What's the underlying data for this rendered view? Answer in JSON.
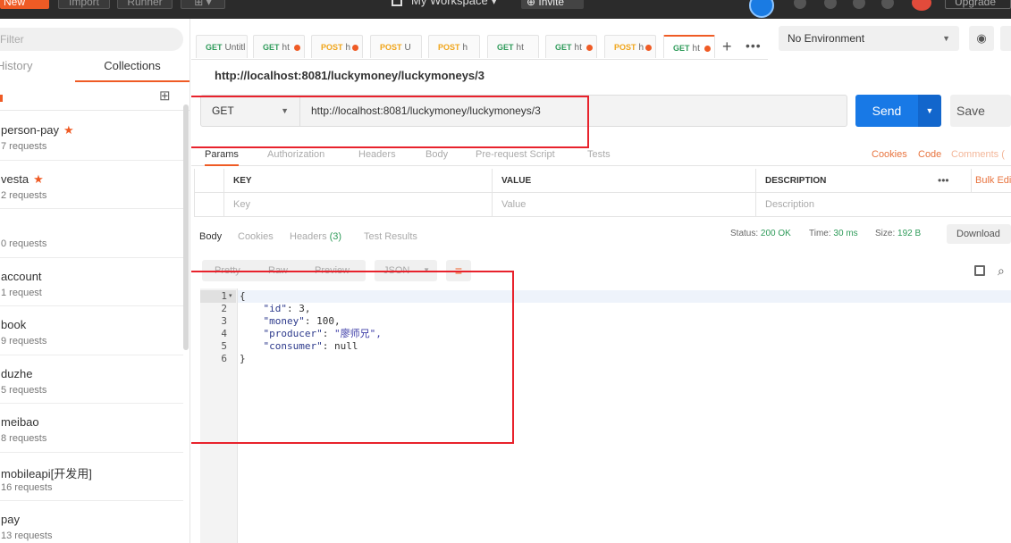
{
  "topbar": {
    "new_label": "New",
    "import_label": "Import",
    "runner_label": "Runner",
    "workspace_label": "My Workspace",
    "invite_label": "Invite",
    "upgrade_label": "Upgrade"
  },
  "sidebar": {
    "filter_placeholder": "Filter",
    "tab_history": "History",
    "tab_collections": "Collections",
    "collections": [
      {
        "name": "person-pay",
        "count": "7 requests",
        "starred": true
      },
      {
        "name": "vesta",
        "count": "2 requests",
        "starred": true
      },
      {
        "name": "",
        "count": "0 requests",
        "starred": false
      },
      {
        "name": "account",
        "count": "1 request",
        "starred": false
      },
      {
        "name": "book",
        "count": "9 requests",
        "starred": false
      },
      {
        "name": "duzhe",
        "count": "5 requests",
        "starred": false
      },
      {
        "name": "meibao",
        "count": "8 requests",
        "starred": false
      },
      {
        "name": "mobileapi[开发用]",
        "count": "16 requests",
        "starred": false
      },
      {
        "name": "pay",
        "count": "13 requests",
        "starred": false
      }
    ]
  },
  "tabs": [
    {
      "method": "GET",
      "title": "Untitl",
      "dot": false
    },
    {
      "method": "GET",
      "title": "ht",
      "dot": true
    },
    {
      "method": "POST",
      "title": "h",
      "dot": true
    },
    {
      "method": "POST",
      "title": "U",
      "dot": false
    },
    {
      "method": "POST",
      "title": "h",
      "dot": false
    },
    {
      "method": "GET",
      "title": "ht",
      "dot": false
    },
    {
      "method": "GET",
      "title": "ht",
      "dot": true
    },
    {
      "method": "POST",
      "title": "h",
      "dot": true
    },
    {
      "method": "GET",
      "title": "ht",
      "dot": true
    }
  ],
  "environment": {
    "selected": "No Environment"
  },
  "request": {
    "title": "http://localhost:8081/luckymoney/luckymoneys/3",
    "method": "GET",
    "url": "http://localhost:8081/luckymoney/luckymoneys/3",
    "send_label": "Send",
    "save_label": "Save"
  },
  "request_tabs": {
    "params": "Params",
    "authorization": "Authorization",
    "headers": "Headers",
    "body": "Body",
    "prerequest": "Pre-request Script",
    "tests": "Tests",
    "cookies": "Cookies",
    "code": "Code",
    "comments": "Comments ("
  },
  "params_table": {
    "col_key": "KEY",
    "col_value": "VALUE",
    "col_description": "DESCRIPTION",
    "more": "•••",
    "bulk_edit": "Bulk Edi",
    "ph_key": "Key",
    "ph_value": "Value",
    "ph_description": "Description"
  },
  "response": {
    "tab_body": "Body",
    "tab_cookies": "Cookies",
    "tab_headers": "Headers",
    "headers_count": "(3)",
    "tab_tests": "Test Results",
    "status_label": "Status:",
    "status_value": "200 OK",
    "time_label": "Time:",
    "time_value": "30 ms",
    "size_label": "Size:",
    "size_value": "192 B",
    "download_label": "Download",
    "fmt_pretty": "Pretty",
    "fmt_raw": "Raw",
    "fmt_preview": "Preview",
    "fmt_json": "JSON"
  },
  "code_lines": [
    {
      "num": "1",
      "text": "{"
    },
    {
      "num": "2",
      "key": "\"id\"",
      "value": " 3,"
    },
    {
      "num": "3",
      "key": "\"money\"",
      "value": " 100,"
    },
    {
      "num": "4",
      "key": "\"producer\"",
      "value": " \"廖师兄\","
    },
    {
      "num": "5",
      "key": "\"consumer\"",
      "value": " null"
    },
    {
      "num": "6",
      "text": "}"
    }
  ],
  "colors": {
    "accent_orange": "#ef5b25",
    "send_blue": "#1879e6",
    "highlight_red": "#e8222c",
    "status_green": "#2f9b5a"
  }
}
